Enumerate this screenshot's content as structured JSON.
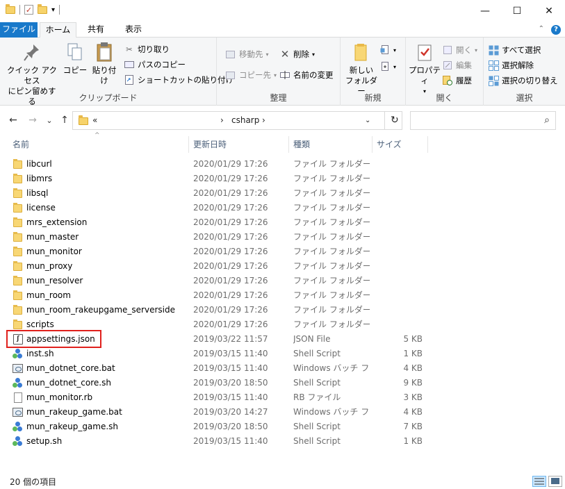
{
  "window": {
    "minimize": "—",
    "maximize": "☐",
    "close": "✕"
  },
  "tabs": {
    "file": "ファイル",
    "home": "ホーム",
    "share": "共有",
    "view": "表示"
  },
  "ribbon": {
    "clipboard": {
      "label": "クリップボード",
      "pin_line1": "クイック アクセス",
      "pin_line2": "にピン留めする",
      "copy": "コピー",
      "paste": "貼り付け",
      "cut": "切り取り",
      "copy_path": "パスのコピー",
      "paste_shortcut": "ショートカットの貼り付け"
    },
    "organize": {
      "label": "整理",
      "move_to": "移動先",
      "copy_to": "コピー先",
      "delete": "削除",
      "rename": "名前の変更"
    },
    "new": {
      "label": "新規",
      "new_folder_line1": "新しい",
      "new_folder_line2": "フォルダー"
    },
    "open": {
      "label": "開く",
      "properties": "プロパティ",
      "open": "開く",
      "edit": "編集",
      "history": "履歴"
    },
    "select": {
      "label": "選択",
      "select_all": "すべて選択",
      "select_none": "選択解除",
      "invert": "選択の切り替え"
    }
  },
  "nav": {
    "back": "←",
    "forward": "→",
    "recent": "⌄",
    "up": "↑",
    "address_overflow": "«",
    "address_current": "csharp",
    "address_sep": "›",
    "refresh": "↻",
    "search_placeholder": ""
  },
  "columns": {
    "name": "名前",
    "date": "更新日時",
    "type": "種類",
    "size": "サイズ",
    "sort_indicator": "^"
  },
  "files": [
    {
      "name": "libcurl",
      "date": "2020/01/29 17:26",
      "type": "ファイル フォルダー",
      "size": "",
      "icon": "folder"
    },
    {
      "name": "libmrs",
      "date": "2020/01/29 17:26",
      "type": "ファイル フォルダー",
      "size": "",
      "icon": "folder"
    },
    {
      "name": "libsql",
      "date": "2020/01/29 17:26",
      "type": "ファイル フォルダー",
      "size": "",
      "icon": "folder"
    },
    {
      "name": "license",
      "date": "2020/01/29 17:26",
      "type": "ファイル フォルダー",
      "size": "",
      "icon": "folder"
    },
    {
      "name": "mrs_extension",
      "date": "2020/01/29 17:26",
      "type": "ファイル フォルダー",
      "size": "",
      "icon": "folder"
    },
    {
      "name": "mun_master",
      "date": "2020/01/29 17:26",
      "type": "ファイル フォルダー",
      "size": "",
      "icon": "folder"
    },
    {
      "name": "mun_monitor",
      "date": "2020/01/29 17:26",
      "type": "ファイル フォルダー",
      "size": "",
      "icon": "folder"
    },
    {
      "name": "mun_proxy",
      "date": "2020/01/29 17:26",
      "type": "ファイル フォルダー",
      "size": "",
      "icon": "folder"
    },
    {
      "name": "mun_resolver",
      "date": "2020/01/29 17:26",
      "type": "ファイル フォルダー",
      "size": "",
      "icon": "folder"
    },
    {
      "name": "mun_room",
      "date": "2020/01/29 17:26",
      "type": "ファイル フォルダー",
      "size": "",
      "icon": "folder"
    },
    {
      "name": "mun_room_rakeupgame_serverside",
      "date": "2020/01/29 17:26",
      "type": "ファイル フォルダー",
      "size": "",
      "icon": "folder"
    },
    {
      "name": "scripts",
      "date": "2020/01/29 17:26",
      "type": "ファイル フォルダー",
      "size": "",
      "icon": "folder"
    },
    {
      "name": "appsettings.json",
      "date": "2019/03/22 11:57",
      "type": "JSON File",
      "size": "5 KB",
      "icon": "json"
    },
    {
      "name": "inst.sh",
      "date": "2019/03/15 11:40",
      "type": "Shell Script",
      "size": "1 KB",
      "icon": "sh"
    },
    {
      "name": "mun_dotnet_core.bat",
      "date": "2019/03/15 11:40",
      "type": "Windows バッチ ファ...",
      "size": "4 KB",
      "icon": "bat"
    },
    {
      "name": "mun_dotnet_core.sh",
      "date": "2019/03/20 18:50",
      "type": "Shell Script",
      "size": "9 KB",
      "icon": "sh"
    },
    {
      "name": "mun_monitor.rb",
      "date": "2019/03/15 11:40",
      "type": "RB ファイル",
      "size": "3 KB",
      "icon": "doc"
    },
    {
      "name": "mun_rakeup_game.bat",
      "date": "2019/03/20 14:27",
      "type": "Windows バッチ ファ...",
      "size": "4 KB",
      "icon": "bat"
    },
    {
      "name": "mun_rakeup_game.sh",
      "date": "2019/03/20 18:50",
      "type": "Shell Script",
      "size": "7 KB",
      "icon": "sh"
    },
    {
      "name": "setup.sh",
      "date": "2019/03/15 11:40",
      "type": "Shell Script",
      "size": "1 KB",
      "icon": "sh"
    }
  ],
  "status": {
    "item_count": "20 個の項目"
  },
  "colors": {
    "accent": "#1979ca",
    "highlight_box": "#e0201c",
    "folder": "#f8d775"
  }
}
